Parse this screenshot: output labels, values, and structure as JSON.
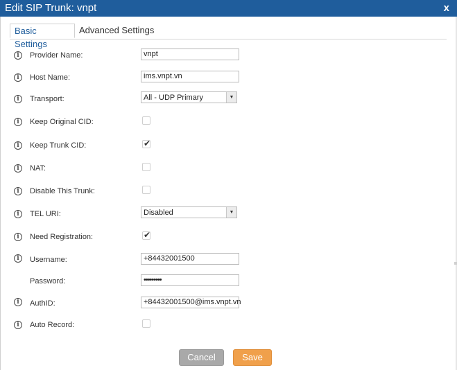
{
  "dialog": {
    "title": "Edit SIP Trunk: vnpt",
    "close_label": "x"
  },
  "tabs": [
    {
      "label": "Basic Settings",
      "active": true
    },
    {
      "label": "Advanced Settings",
      "active": false
    }
  ],
  "fields": {
    "provider_name": {
      "label": "Provider Name:",
      "value": "vnpt"
    },
    "host_name": {
      "label": "Host Name:",
      "value": "ims.vnpt.vn"
    },
    "transport": {
      "label": "Transport:",
      "value": "All - UDP Primary"
    },
    "keep_original_cid": {
      "label": "Keep Original CID:",
      "checked": false
    },
    "keep_trunk_cid": {
      "label": "Keep Trunk CID:",
      "checked": true
    },
    "nat": {
      "label": "NAT:",
      "checked": false
    },
    "disable_this_trunk": {
      "label": "Disable This Trunk:",
      "checked": false
    },
    "tel_uri": {
      "label": "TEL URI:",
      "value": "Disabled"
    },
    "need_registration": {
      "label": "Need Registration:",
      "checked": true
    },
    "username": {
      "label": "Username:",
      "value": "+84432001500"
    },
    "password": {
      "label": "Password:",
      "value": "•••••••••"
    },
    "authid": {
      "label": "AuthID:",
      "value": "+84432001500@ims.vnpt.vn"
    },
    "auto_record": {
      "label": "Auto Record:",
      "checked": false
    }
  },
  "icons": {
    "info": "info-icon",
    "checkmark": "checkmark-icon",
    "dropdown": "chevron-down-icon"
  },
  "buttons": {
    "cancel_label": "Cancel",
    "save_label": "Save"
  },
  "colors": {
    "titlebar": "#1f5d9c",
    "active_tab_text": "#1f5d9c",
    "cancel_button": "#a9a9a9",
    "save_button": "#f0a04b"
  }
}
